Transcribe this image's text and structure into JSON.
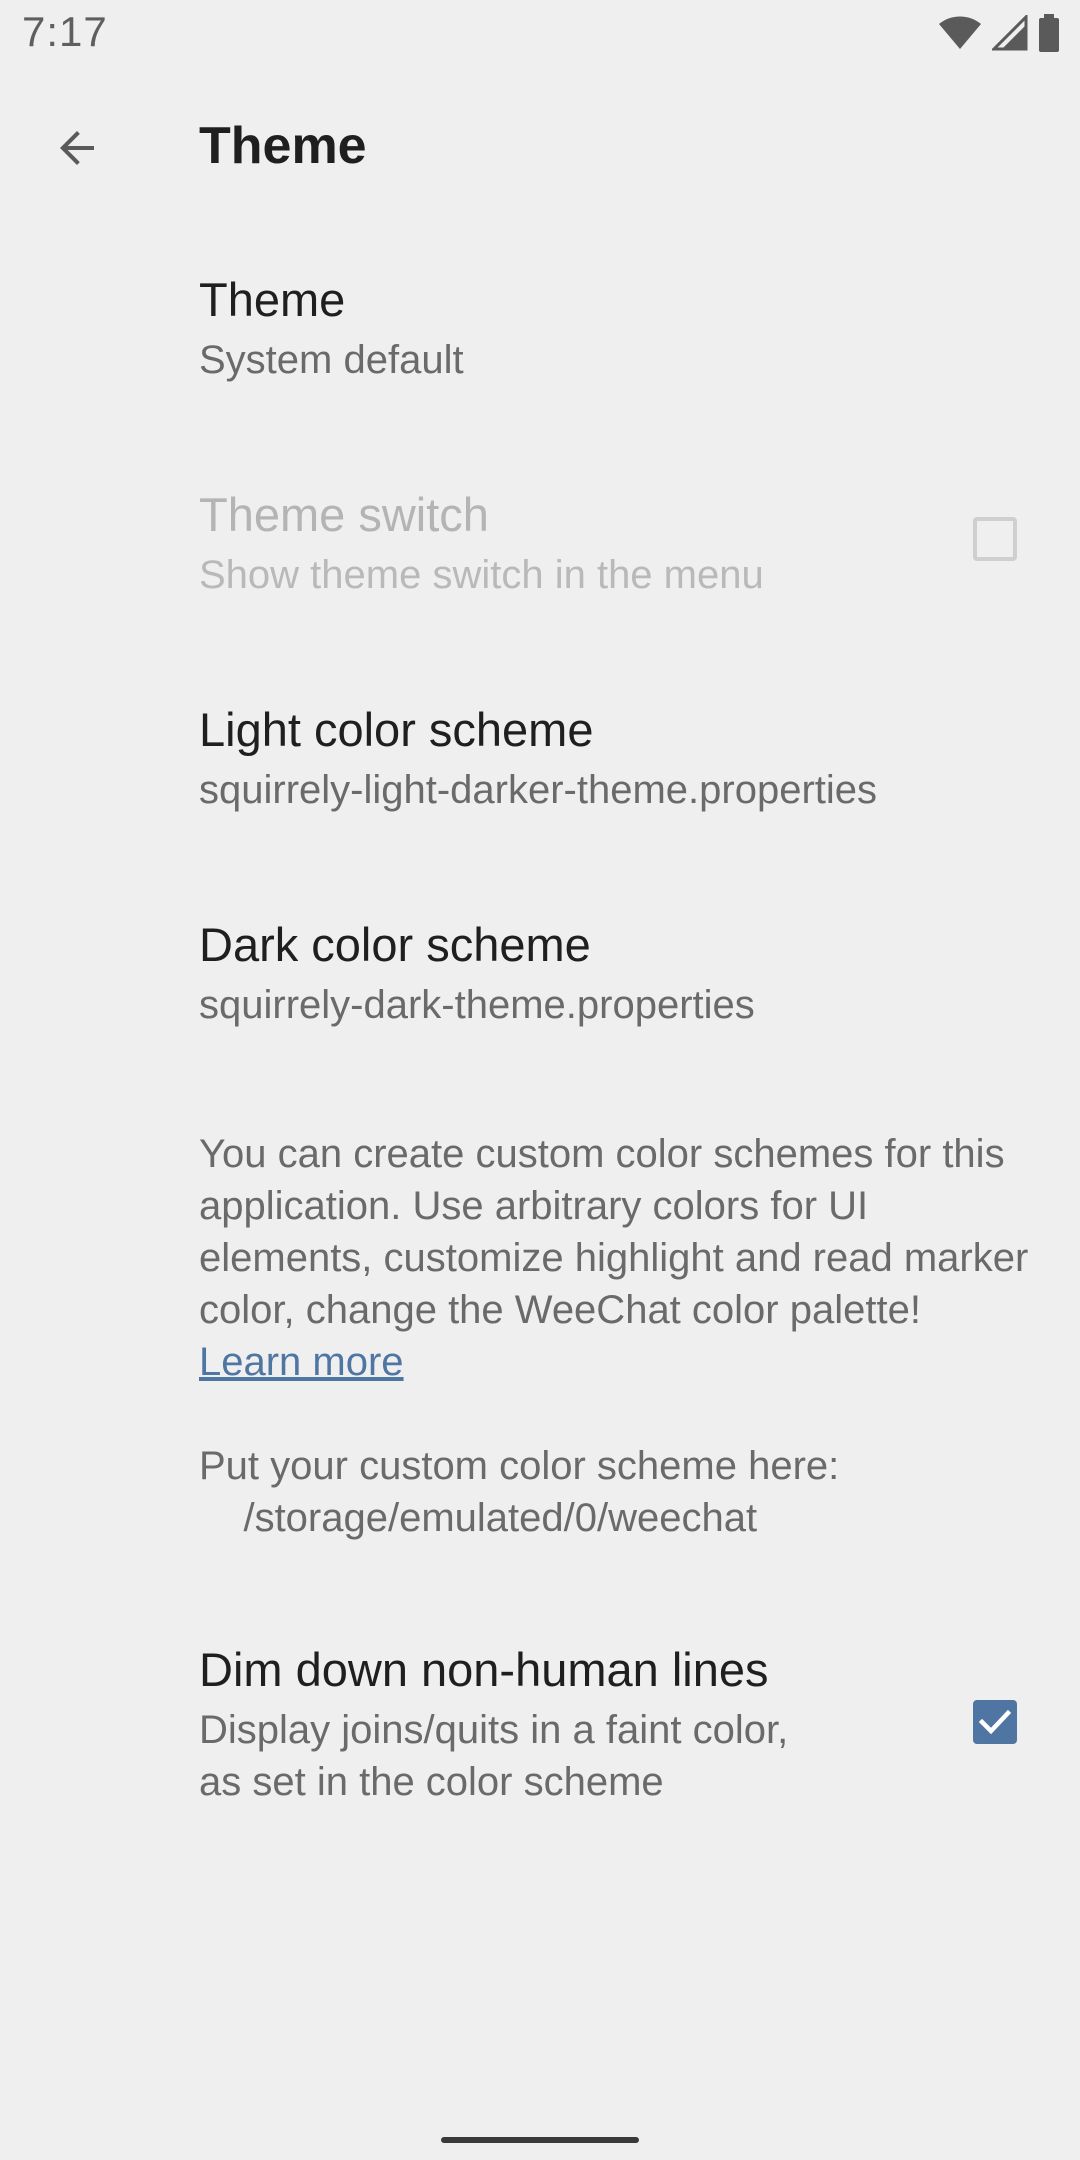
{
  "status_bar": {
    "time": "7:17",
    "icons": [
      "wifi-icon",
      "cell-signal-icon",
      "battery-icon"
    ]
  },
  "toolbar": {
    "back_icon": "arrow-back-icon",
    "title": "Theme"
  },
  "prefs": {
    "theme": {
      "title": "Theme",
      "summary": "System default"
    },
    "theme_switch": {
      "title": "Theme switch",
      "summary": "Show theme switch in the menu",
      "checked": false,
      "enabled": false
    },
    "light_scheme": {
      "title": "Light color scheme",
      "summary": "squirrely-light-darker-theme.properties"
    },
    "dark_scheme": {
      "title": "Dark color scheme",
      "summary": "squirrely-dark-theme.properties"
    },
    "info": {
      "text": "You can create custom color schemes for this application. Use arbitrary colors for UI elements, customize highlight and read marker color, change the WeeChat color palette! ",
      "link": "Learn more",
      "path_label": "Put your custom color scheme here:",
      "path": "    /storage/emulated/0/weechat"
    },
    "dim_down": {
      "title": "Dim down non-human lines",
      "summary_line1": "Display joins/quits in a faint color,",
      "summary_line2": "as set in the color scheme",
      "checked": true
    }
  },
  "colors": {
    "background": "#efefef",
    "accent": "#4f76a3",
    "text_primary": "#1f1f1f",
    "text_secondary": "#6a6a6a",
    "text_disabled": "#b4b4b4"
  }
}
